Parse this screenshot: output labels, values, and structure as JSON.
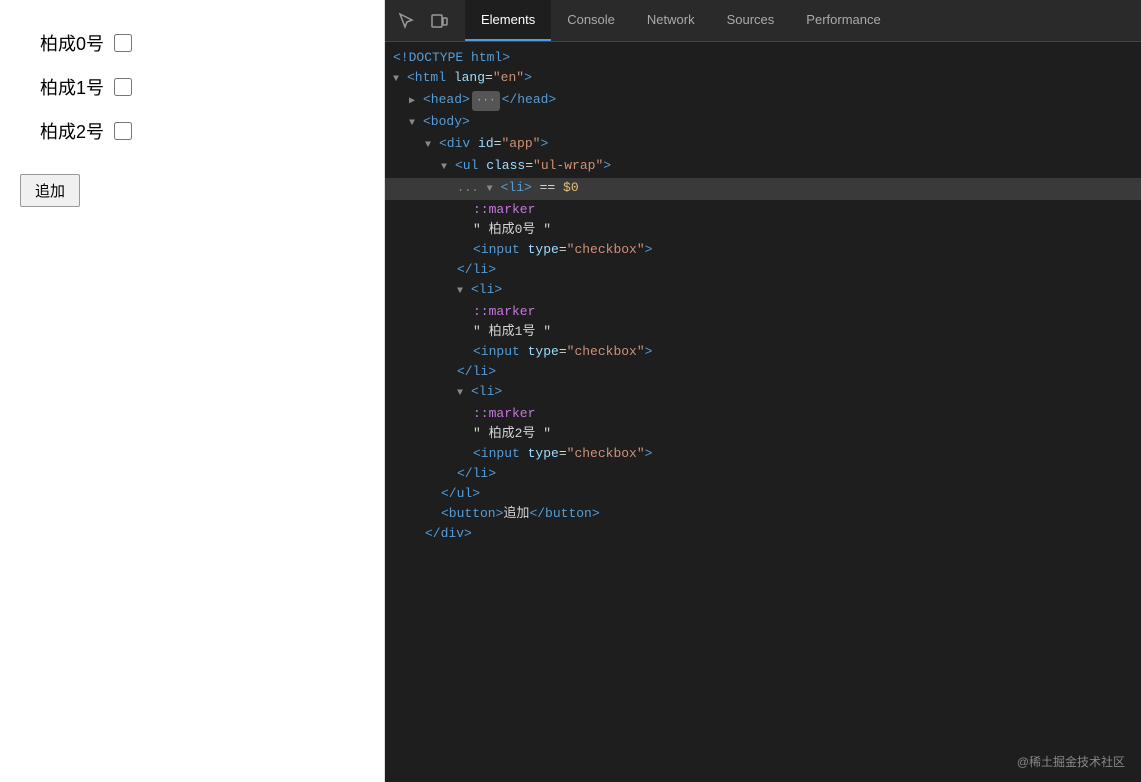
{
  "leftPanel": {
    "listItems": [
      {
        "label": "柏成0号"
      },
      {
        "label": "柏成1号"
      },
      {
        "label": "柏成2号"
      }
    ],
    "addButton": "追加"
  },
  "devtools": {
    "tabs": [
      {
        "id": "elements",
        "label": "Elements",
        "active": true
      },
      {
        "id": "console",
        "label": "Console",
        "active": false
      },
      {
        "id": "network",
        "label": "Network",
        "active": false
      },
      {
        "id": "sources",
        "label": "Sources",
        "active": false
      },
      {
        "id": "performance",
        "label": "Performance",
        "active": false
      }
    ],
    "codeLines": [
      {
        "indent": 0,
        "content": "<!DOCTYPE html>",
        "type": "doctype",
        "highlighted": false
      },
      {
        "indent": 0,
        "content": "<html lang=\"en\">",
        "type": "tag",
        "highlighted": false
      },
      {
        "indent": 1,
        "content": "head_collapsed",
        "type": "head",
        "highlighted": false
      },
      {
        "indent": 1,
        "content": "<body>",
        "type": "tag",
        "highlighted": false
      },
      {
        "indent": 2,
        "content": "<div id=\"app\">",
        "type": "tag",
        "highlighted": false
      },
      {
        "indent": 3,
        "content": "<ul class=\"ul-wrap\">",
        "type": "tag",
        "highlighted": false
      },
      {
        "indent": 4,
        "content": "li_selected",
        "type": "li",
        "highlighted": true
      },
      {
        "indent": 5,
        "content": "::marker",
        "type": "pseudo",
        "highlighted": false
      },
      {
        "indent": 5,
        "content": "\" 柏成0号 \"",
        "type": "text",
        "highlighted": false
      },
      {
        "indent": 5,
        "content": "<input type=\"checkbox\">",
        "type": "tag",
        "highlighted": false
      },
      {
        "indent": 4,
        "content": "</li>",
        "type": "tag",
        "highlighted": false
      },
      {
        "indent": 4,
        "content": "<li>",
        "type": "li2",
        "highlighted": false
      },
      {
        "indent": 5,
        "content": "::marker",
        "type": "pseudo",
        "highlighted": false
      },
      {
        "indent": 5,
        "content": "\" 柏成1号 \"",
        "type": "text",
        "highlighted": false
      },
      {
        "indent": 5,
        "content": "<input type=\"checkbox\">",
        "type": "tag",
        "highlighted": false
      },
      {
        "indent": 4,
        "content": "</li>",
        "type": "tag",
        "highlighted": false
      },
      {
        "indent": 4,
        "content": "<li>",
        "type": "li3",
        "highlighted": false
      },
      {
        "indent": 5,
        "content": "::marker",
        "type": "pseudo",
        "highlighted": false
      },
      {
        "indent": 5,
        "content": "\" 柏成2号 \"",
        "type": "text",
        "highlighted": false
      },
      {
        "indent": 5,
        "content": "<input type=\"checkbox\">",
        "type": "tag",
        "highlighted": false
      },
      {
        "indent": 4,
        "content": "</li>",
        "type": "tag",
        "highlighted": false
      },
      {
        "indent": 3,
        "content": "</ul>",
        "type": "tag",
        "highlighted": false
      },
      {
        "indent": 3,
        "content": "<button>追加</button>",
        "type": "button",
        "highlighted": false
      },
      {
        "indent": 2,
        "content": "</div>",
        "type": "tag",
        "highlighted": false
      }
    ]
  },
  "watermark": "@稀土掘金技术社区"
}
